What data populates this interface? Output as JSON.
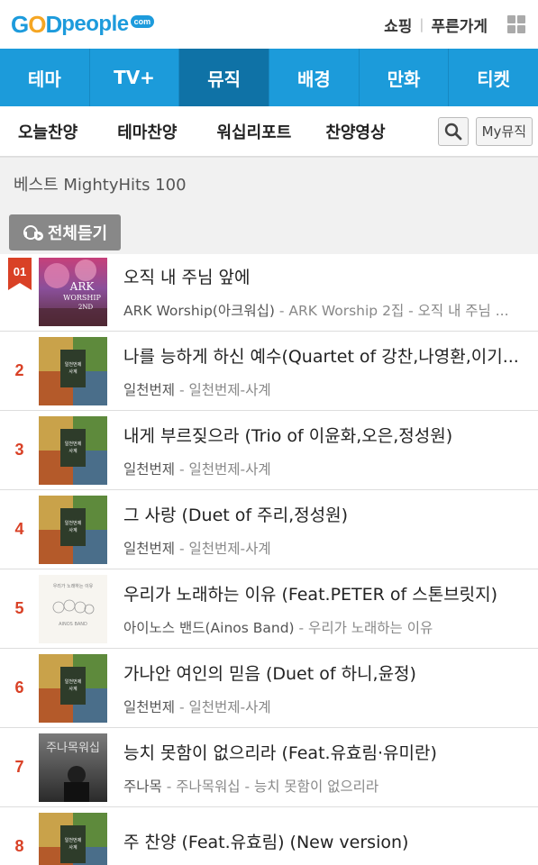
{
  "header": {
    "logo_god": "GOD",
    "logo_people": "people",
    "logo_com": "com",
    "shopping": "쇼핑",
    "store": "푸른가게"
  },
  "nav": [
    "테마",
    "TV+",
    "뮤직",
    "배경",
    "만화",
    "티켓"
  ],
  "subnav": [
    "오늘찬양",
    "테마찬양",
    "워십리포트",
    "찬양영상"
  ],
  "my_button": "My뮤직",
  "section_title": "베스트 MightyHits 100",
  "play_all": "전체듣기",
  "accent_color": "#1c9bda",
  "rank_color": "#d94126",
  "songs": [
    {
      "rank": "01",
      "title": "오직 내 주님 앞에",
      "artist": "ARK Worship(아크워십)",
      "album": " - ARK Worship 2집 - 오직 내 주님 ...",
      "cover": "ark"
    },
    {
      "rank": "2",
      "title": "나를 능하게 하신 예수(Quartet of 강찬,나영환,이기...",
      "artist": "일천번제",
      "album": " - 일천번제-사계",
      "cover": "seasons"
    },
    {
      "rank": "3",
      "title": "내게 부르짖으라 (Trio of 이윤화,오은,정성원)",
      "artist": "일천번제",
      "album": " - 일천번제-사계",
      "cover": "seasons"
    },
    {
      "rank": "4",
      "title": "그 사랑 (Duet of 주리,정성원)",
      "artist": "일천번제",
      "album": " - 일천번제-사계",
      "cover": "seasons"
    },
    {
      "rank": "5",
      "title": "우리가 노래하는 이유 (Feat.PETER of 스톤브릿지)",
      "artist": "아이노스 밴드(Ainos Band)",
      "album": " - 우리가 노래하는 이유",
      "cover": "ainos"
    },
    {
      "rank": "6",
      "title": "가나안 여인의 믿음 (Duet of 하니,윤정)",
      "artist": "일천번제",
      "album": " - 일천번제-사계",
      "cover": "seasons"
    },
    {
      "rank": "7",
      "title": "능치 못함이 없으리라 (Feat.유효림·유미란)",
      "artist": "주나목",
      "album": " - 주나목워십 - 능치 못함이 없으리라",
      "cover": "junamok"
    },
    {
      "rank": "8",
      "title": "주 찬양 (Feat.유효림) (New version)",
      "artist": "",
      "album": "",
      "cover": "seasons"
    }
  ]
}
